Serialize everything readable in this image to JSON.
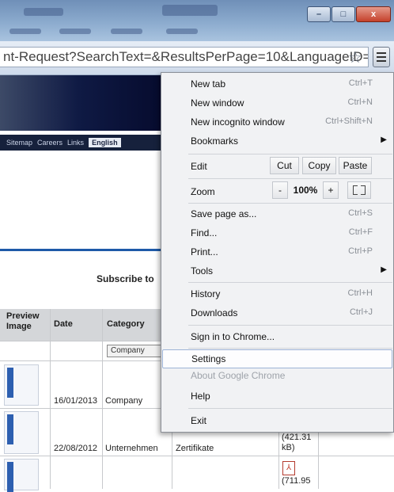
{
  "window": {
    "minimize_glyph": "–",
    "maximize_glyph": "□",
    "close_glyph": "x"
  },
  "toolbar": {
    "url": "nt-Request?SearchText=&ResultsPerPage=10&LanguageID=",
    "star_icon": "☆"
  },
  "page": {
    "nav_links": [
      "Sitemap",
      "Careers",
      "Links"
    ],
    "language": "English",
    "subscribe_text": "Subscribe to",
    "table": {
      "headers": [
        "Preview Image",
        "Date",
        "Category"
      ],
      "filter_value": "Company",
      "rows": [
        {
          "date": "16/01/2013",
          "category": "Company",
          "type": "",
          "size": ""
        },
        {
          "date": "22/08/2012",
          "category": "Unternehmen",
          "type": "Zertifikate",
          "size": "(421.31 kB)"
        },
        {
          "date": "",
          "category": "",
          "type": "",
          "size": "(711.95"
        }
      ]
    }
  },
  "menu": {
    "items_top": [
      {
        "label": "New tab",
        "shortcut": "Ctrl+T"
      },
      {
        "label": "New window",
        "shortcut": "Ctrl+N"
      },
      {
        "label": "New incognito window",
        "shortcut": "Ctrl+Shift+N"
      },
      {
        "label": "Bookmarks",
        "shortcut": ""
      }
    ],
    "edit": {
      "label": "Edit",
      "cut": "Cut",
      "copy": "Copy",
      "paste": "Paste"
    },
    "zoom": {
      "label": "Zoom",
      "minus": "-",
      "value": "100%",
      "plus": "+"
    },
    "items_mid": [
      {
        "label": "Save page as...",
        "shortcut": "Ctrl+S"
      },
      {
        "label": "Find...",
        "shortcut": "Ctrl+F"
      },
      {
        "label": "Print...",
        "shortcut": "Ctrl+P"
      },
      {
        "label": "Tools",
        "shortcut": ""
      }
    ],
    "items_hist": [
      {
        "label": "History",
        "shortcut": "Ctrl+H"
      },
      {
        "label": "Downloads",
        "shortcut": "Ctrl+J"
      }
    ],
    "sign_in": "Sign in to Chrome...",
    "settings": "Settings",
    "about": "About Google Chrome",
    "help": "Help",
    "exit": "Exit"
  }
}
